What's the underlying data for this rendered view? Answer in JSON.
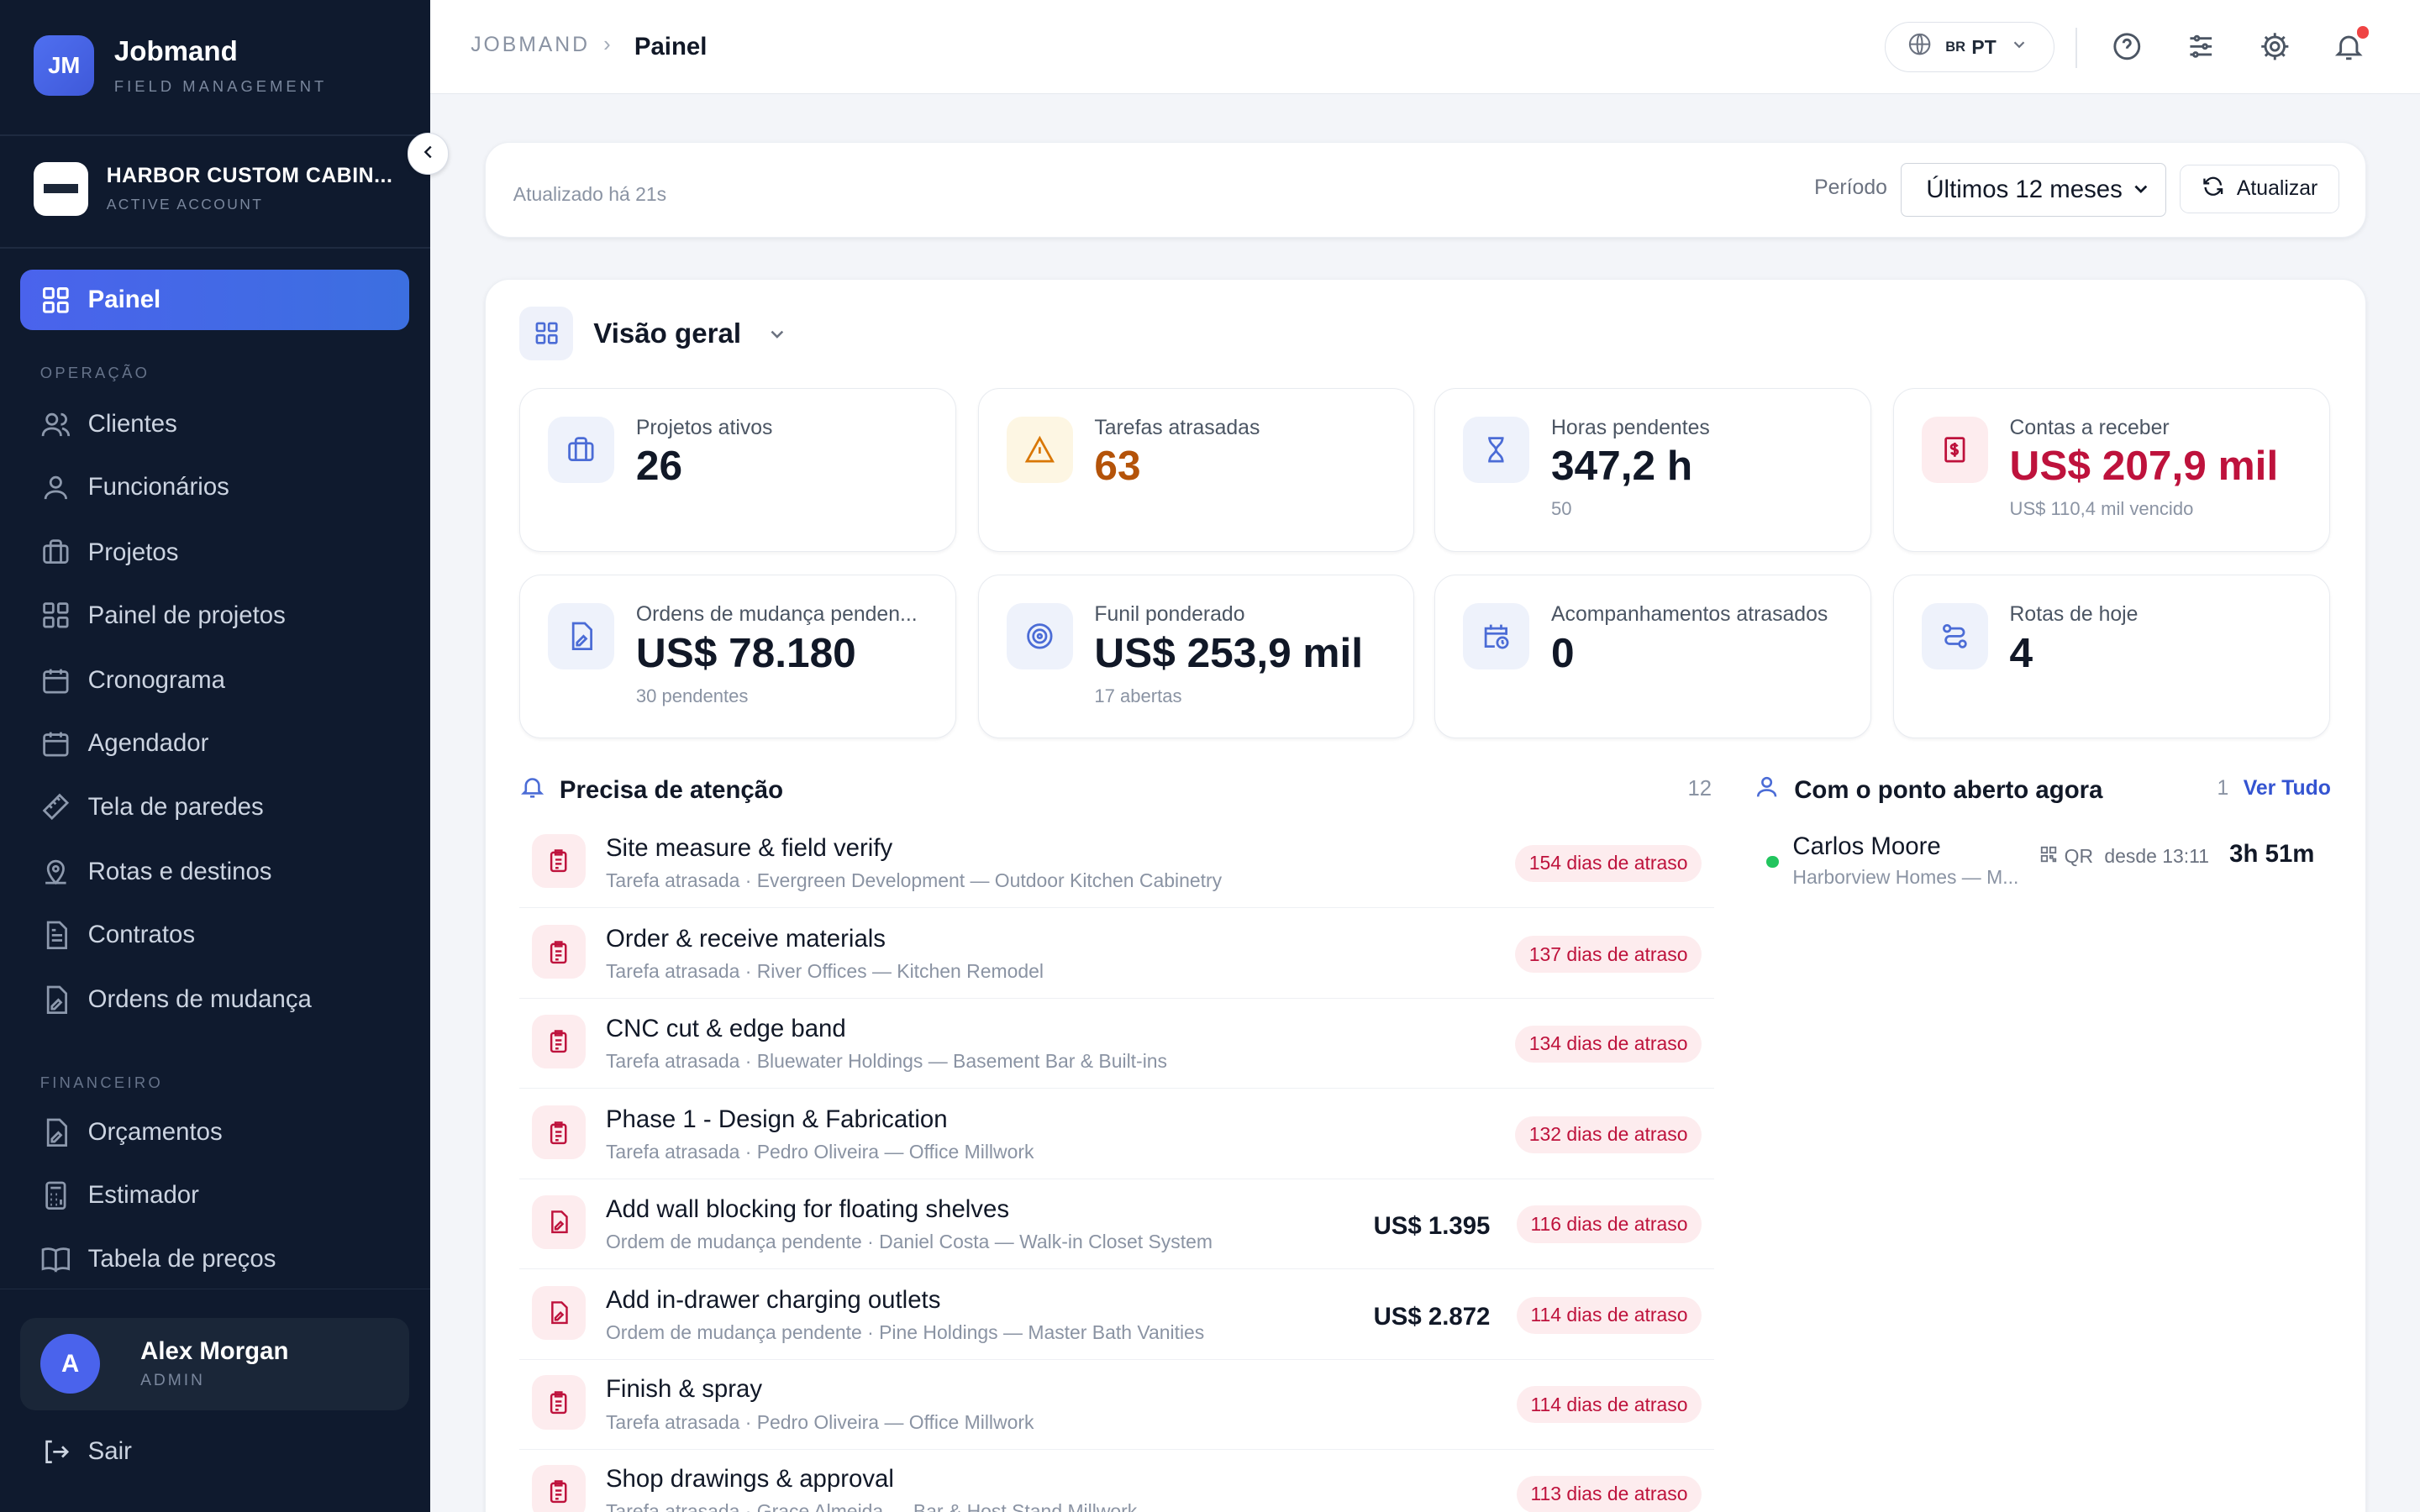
{
  "brand": {
    "logo": "JM",
    "name": "Jobmand",
    "subtitle": "FIELD MANAGEMENT"
  },
  "account": {
    "name": "HARBOR CUSTOM CABIN...",
    "status": "ACTIVE ACCOUNT"
  },
  "sidebar": {
    "active": {
      "label": "Painel",
      "icon": "grid-icon"
    },
    "sections": [
      {
        "title": "OPERAÇÃO",
        "items": [
          {
            "label": "Clientes",
            "icon": "users-icon"
          },
          {
            "label": "Funcionários",
            "icon": "user-icon"
          },
          {
            "label": "Projetos",
            "icon": "briefcase-icon"
          },
          {
            "label": "Painel de projetos",
            "icon": "grid-icon"
          },
          {
            "label": "Cronograma",
            "icon": "calendar-icon"
          },
          {
            "label": "Agendador",
            "icon": "calendar-icon"
          },
          {
            "label": "Tela de paredes",
            "icon": "ruler-icon"
          },
          {
            "label": "Rotas e destinos",
            "icon": "map-pin-icon"
          },
          {
            "label": "Contratos",
            "icon": "file-text-icon"
          },
          {
            "label": "Ordens de mudança",
            "icon": "file-edit-icon"
          }
        ]
      },
      {
        "title": "FINANCEIRO",
        "items": [
          {
            "label": "Orçamentos",
            "icon": "file-edit-icon"
          },
          {
            "label": "Estimador",
            "icon": "calculator-icon"
          },
          {
            "label": "Tabela de preços",
            "icon": "book-icon"
          }
        ]
      }
    ]
  },
  "user": {
    "initial": "A",
    "name": "Alex Morgan",
    "role": "ADMIN"
  },
  "logout_label": "Sair",
  "breadcrumb": {
    "root": "JOBMAND",
    "separator": "›",
    "current": "Painel"
  },
  "language": {
    "flag": "BR",
    "code": "PT"
  },
  "toolbar": {
    "updated": "Atualizado há 21s",
    "period_label": "Período",
    "period_value": "Últimos 12 meses",
    "refresh_label": "Atualizar"
  },
  "overview": {
    "title": "Visão geral",
    "stats": [
      {
        "label": "Projetos ativos",
        "value": "26",
        "sub": "",
        "icon": "briefcase-icon",
        "tone": "blue"
      },
      {
        "label": "Tarefas atrasadas",
        "value": "63",
        "sub": "",
        "icon": "warning-icon",
        "tone": "amber"
      },
      {
        "label": "Horas pendentes",
        "value": "347,2 h",
        "sub": "50",
        "icon": "hourglass-icon",
        "tone": "blue"
      },
      {
        "label": "Contas a receber",
        "value": "US$ 207,9 mil",
        "sub": "US$ 110,4 mil vencido",
        "icon": "invoice-icon",
        "tone": "red"
      },
      {
        "label": "Ordens de mudança penden...",
        "value": "US$ 78.180",
        "sub": "30 pendentes",
        "icon": "file-edit-icon",
        "tone": "blue"
      },
      {
        "label": "Funil ponderado",
        "value": "US$ 253,9 mil",
        "sub": "17 abertas",
        "icon": "target-icon",
        "tone": "blue"
      },
      {
        "label": "Acompanhamentos atrasados",
        "value": "0",
        "sub": "",
        "icon": "calendar-clock-icon",
        "tone": "blue"
      },
      {
        "label": "Rotas de hoje",
        "value": "4",
        "sub": "",
        "icon": "route-icon",
        "tone": "blue"
      }
    ]
  },
  "colors": {
    "accent": "#4a63ec",
    "sidebar_bg": "#0f1a2e",
    "danger": "#be123c",
    "warning": "#b45309",
    "online": "#22c55e"
  },
  "attention": {
    "title": "Precisa de atenção",
    "count": "12",
    "items": [
      {
        "title": "Site measure & field verify",
        "sub": "Tarefa atrasada · Evergreen Development — Outdoor Kitchen Cabinetry",
        "amount": "",
        "badge": "154 dias de atraso",
        "icon": "clipboard-icon"
      },
      {
        "title": "Order & receive materials",
        "sub": "Tarefa atrasada · River Offices — Kitchen Remodel",
        "amount": "",
        "badge": "137 dias de atraso",
        "icon": "clipboard-icon"
      },
      {
        "title": "CNC cut & edge band",
        "sub": "Tarefa atrasada · Bluewater Holdings — Basement Bar & Built-ins",
        "amount": "",
        "badge": "134 dias de atraso",
        "icon": "clipboard-icon"
      },
      {
        "title": "Phase 1 - Design & Fabrication",
        "sub": "Tarefa atrasada · Pedro Oliveira — Office Millwork",
        "amount": "",
        "badge": "132 dias de atraso",
        "icon": "clipboard-icon"
      },
      {
        "title": "Add wall blocking for floating shelves",
        "sub": "Ordem de mudança pendente · Daniel Costa — Walk-in Closet System",
        "amount": "US$ 1.395",
        "badge": "116 dias de atraso",
        "icon": "file-edit-icon"
      },
      {
        "title": "Add in-drawer charging outlets",
        "sub": "Ordem de mudança pendente · Pine Holdings — Master Bath Vanities",
        "amount": "US$ 2.872",
        "badge": "114 dias de atraso",
        "icon": "file-edit-icon"
      },
      {
        "title": "Finish & spray",
        "sub": "Tarefa atrasada · Pedro Oliveira — Office Millwork",
        "amount": "",
        "badge": "114 dias de atraso",
        "icon": "clipboard-icon"
      },
      {
        "title": "Shop drawings & approval",
        "sub": "Tarefa atrasada · Grace Almeida — Bar & Host Stand Millwork",
        "amount": "",
        "badge": "113 dias de atraso",
        "icon": "clipboard-icon"
      }
    ]
  },
  "clocked_in": {
    "title": "Com o ponto aberto agora",
    "count": "1",
    "view_all": "Ver Tudo",
    "items": [
      {
        "name": "Carlos Moore",
        "sub": "Harborview Homes — M...",
        "method": "QR",
        "since": "desde 13:11",
        "duration": "3h 51m"
      }
    ]
  }
}
